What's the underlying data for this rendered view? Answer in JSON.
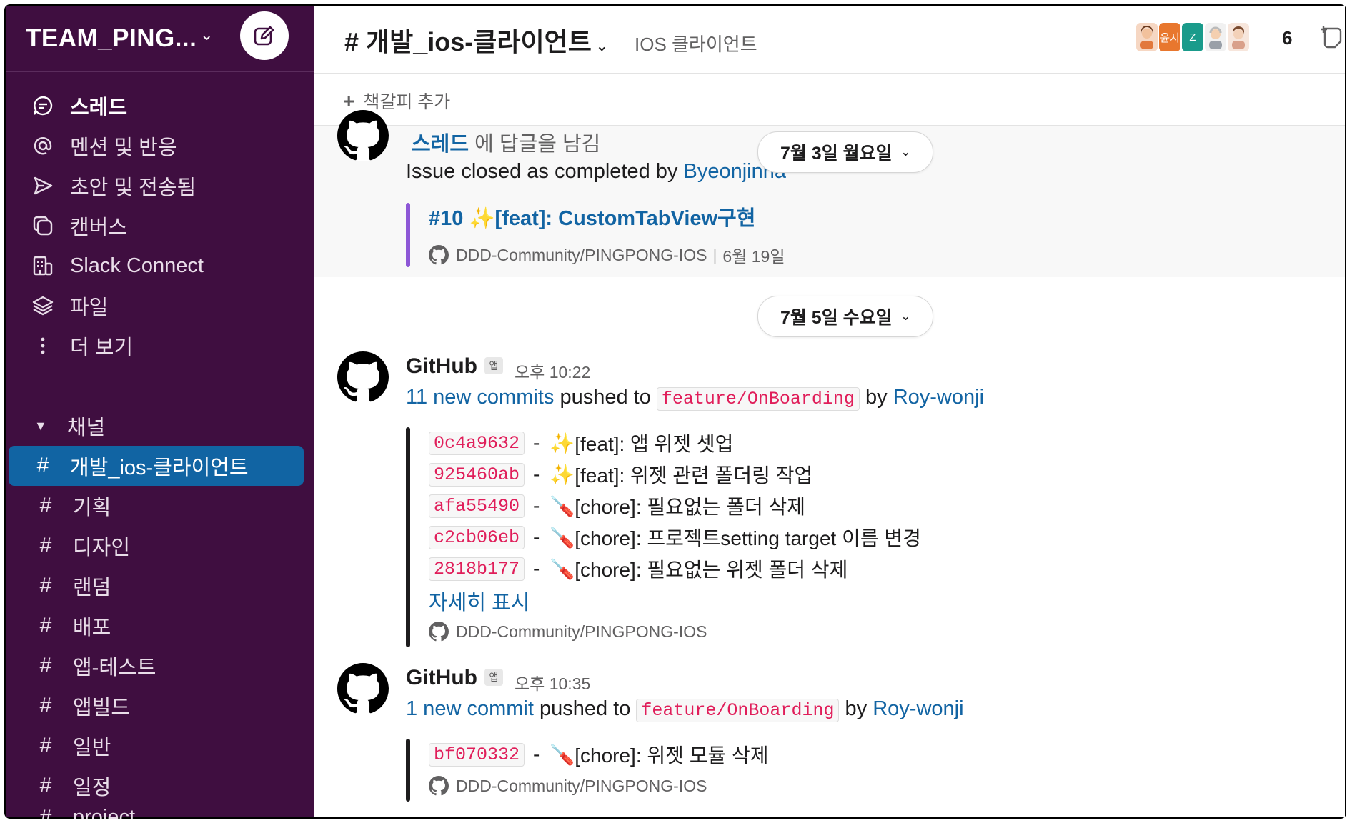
{
  "workspace": {
    "name": "TEAM_PING...",
    "chevron": "⌄"
  },
  "sidebar": {
    "nav": [
      {
        "label": "스레드",
        "icon": "threads-icon"
      },
      {
        "label": "멘션 및 반응",
        "icon": "at-icon"
      },
      {
        "label": "초안 및 전송됨",
        "icon": "send-icon"
      },
      {
        "label": "캔버스",
        "icon": "canvas-icon"
      },
      {
        "label": "Slack Connect",
        "icon": "building-icon"
      },
      {
        "label": "파일",
        "icon": "layers-icon"
      },
      {
        "label": "더 보기",
        "icon": "more-vertical-icon"
      }
    ],
    "channels_header": "채널",
    "channels": [
      "개발_ios-클라이언트",
      "기획",
      "디자인",
      "랜덤",
      "배포",
      "앱-테스트",
      "앱빌드",
      "일반",
      "일정",
      "project"
    ]
  },
  "channel": {
    "title": "# 개발_ios-클라이언트",
    "topic": "IOS 클라이언트",
    "member_count": "6",
    "avatar_labels": [
      "윤지",
      "Z"
    ],
    "bookmark_add": "책갈피 추가"
  },
  "colors": {
    "sidebar_bg": "#3f0e40",
    "active_channel": "#1164a3",
    "link": "#1264a3",
    "code": "#e01e5a",
    "attach_purple": "#8d57d6",
    "attach_dark": "#1d1c1d"
  },
  "messages": {
    "highlight": {
      "thread_link": "스레드",
      "thread_suffix": "에 답글을 남김",
      "closed_text": "Issue closed as completed by",
      "closed_by": "Byeonjinha",
      "issue_title": "#10 ✨[feat]: CustomTabView구현",
      "repo": "DDD-Community/PINGPONG-IOS",
      "separator": "|",
      "date": "6월 19일"
    },
    "dates": {
      "first": "7월 3일 월요일",
      "second": "7월 5일 수요일"
    },
    "msg1": {
      "sender": "GitHub",
      "badge": "앱",
      "time": "오후 10:22",
      "commits_link": "11 new commits",
      "pushed_to": "pushed to",
      "branch": "feature/OnBoarding",
      "by": "by",
      "author": "Roy-wonji",
      "commits": [
        {
          "hash": "0c4a9632",
          "emoji": "✨",
          "message": "[feat]:  앱 위젯 셋업"
        },
        {
          "hash": "925460ab",
          "emoji": "✨",
          "message": "[feat]:  위젯  관련  폴더링 작업"
        },
        {
          "hash": "afa55490",
          "emoji": "🪛",
          "message": "[chore]:   필요없는 폴더  삭제"
        },
        {
          "hash": "c2cb06eb",
          "emoji": "🪛",
          "message": "[chore]:   프로젝트setting target 이름 변경"
        },
        {
          "hash": "2818b177",
          "emoji": "🪛",
          "message": "[chore]:   필요없는 위젯  폴더  삭제"
        }
      ],
      "show_more": "자세히 표시",
      "repo": "DDD-Community/PINGPONG-IOS"
    },
    "msg2": {
      "sender": "GitHub",
      "badge": "앱",
      "time": "오후 10:35",
      "commits_link": "1 new commit",
      "pushed_to": "pushed to",
      "branch": "feature/OnBoarding",
      "by": "by",
      "author": "Roy-wonji",
      "commits": [
        {
          "hash": "bf070332",
          "emoji": "🪛",
          "message": "[chore]:   위젯 모듈  삭제"
        }
      ],
      "repo": "DDD-Community/PINGPONG-IOS"
    }
  }
}
